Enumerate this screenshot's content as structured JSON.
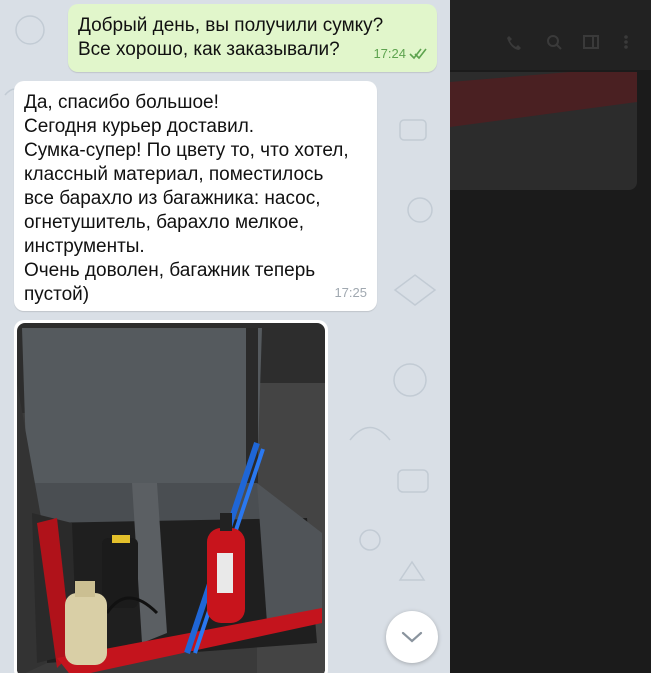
{
  "messages": {
    "outgoing": {
      "line1": "Добрый день, вы получили сумку?",
      "line2": "Все хорошо, как заказывали?",
      "time": "17:24",
      "status_icon": "double-check-icon"
    },
    "incoming": {
      "lines": [
        "Да, спасибо большое!",
        "Сегодня курьер доставил.",
        "Сумка-супер! По цвету то, что хотел,",
        "классный материал, поместилось",
        "все барахло из багажника: насос,",
        "огнетушитель, барахло мелкое,",
        "инструменты.",
        "Очень доволен, багажник теперь",
        "пустой)"
      ],
      "time": "17:25"
    },
    "photo": {
      "subject": "trunk-organizer-photo"
    }
  },
  "scroll_button": {
    "icon": "chevron-down-icon"
  },
  "header_icons": [
    "phone-icon",
    "search-icon",
    "layout-icon",
    "more-icon"
  ],
  "colors": {
    "outgoing_bubble": "#e1f6cb",
    "incoming_bubble": "#ffffff",
    "chat_background": "#d9dfe6",
    "dark_background": "#1b1b1b",
    "check_color": "#5ea34f"
  }
}
